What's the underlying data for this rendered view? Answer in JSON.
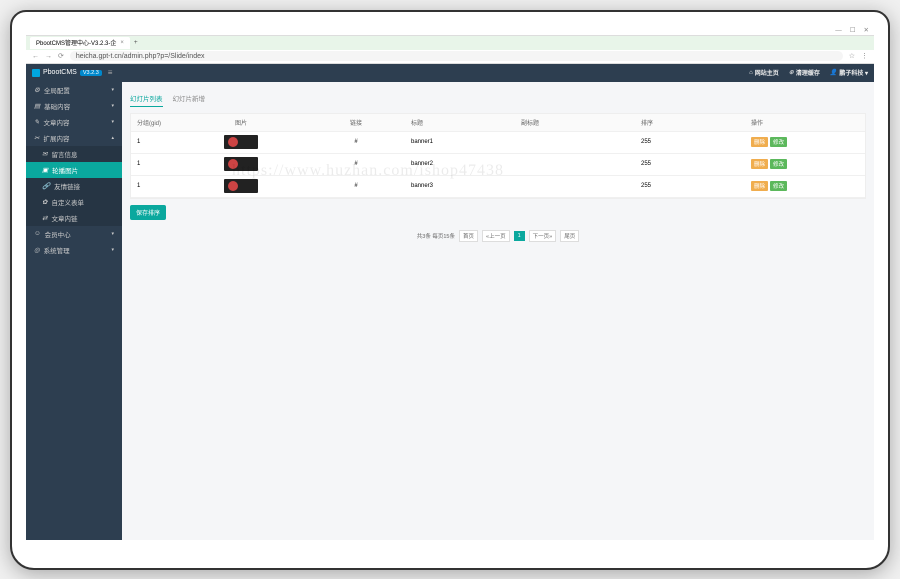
{
  "window": {
    "min": "—",
    "max": "☐",
    "close": "✕"
  },
  "browser": {
    "tab_title": "PbootCMS管理中心-V3.2.3-企",
    "tab_close": "×",
    "add_tab": "+",
    "nav": {
      "back": "←",
      "fwd": "→",
      "reload": "⟳"
    },
    "url": "heicha.gpt-t.cn/admin.php?p=/Slide/index",
    "right_icons": [
      "☆",
      "⋮"
    ]
  },
  "header": {
    "brand": "PbootCMS",
    "ver": "V3.2.3",
    "burger": "≡",
    "links": [
      {
        "icon": "⌂",
        "label": "网站主页"
      },
      {
        "icon": "⊕",
        "label": "清理缓存"
      },
      {
        "icon": "👤",
        "label": "鹏子科技 ▾"
      }
    ]
  },
  "sidebar": [
    {
      "icon": "⚙",
      "label": "全局配置",
      "arr": "▾"
    },
    {
      "icon": "▤",
      "label": "基础内容",
      "arr": "▾"
    },
    {
      "icon": "✎",
      "label": "文章内容",
      "arr": "▾"
    },
    {
      "icon": "✂",
      "label": "扩展内容",
      "arr": "▴",
      "open": true
    },
    {
      "icon": "✉",
      "label": "留言信息",
      "l2": true
    },
    {
      "icon": "▣",
      "label": "轮播图片",
      "l2": true,
      "active": true
    },
    {
      "icon": "🔗",
      "label": "友情链接",
      "l2": true
    },
    {
      "icon": "✿",
      "label": "自定义表单",
      "l2": true
    },
    {
      "icon": "⇄",
      "label": "文章内链",
      "l2": true
    },
    {
      "icon": "☺",
      "label": "会员中心",
      "arr": "▾"
    },
    {
      "icon": "◎",
      "label": "系统管理",
      "arr": "▾"
    }
  ],
  "content": {
    "tabs": [
      {
        "label": "幻灯片列表",
        "active": true
      },
      {
        "label": "幻灯片新增"
      }
    ],
    "cols": [
      "分组(gid)",
      "图片",
      "链接",
      "标题",
      "副标题",
      "排序",
      "操作"
    ],
    "rows": [
      {
        "gid": "1",
        "link": "#",
        "title": "banner1",
        "sub": "",
        "sort": "255"
      },
      {
        "gid": "1",
        "link": "#",
        "title": "banner2",
        "sub": "",
        "sort": "255"
      },
      {
        "gid": "1",
        "link": "#",
        "title": "banner3",
        "sub": "",
        "sort": "255"
      }
    ],
    "row_btn1": "删除",
    "row_btn2": "修改",
    "save": "保存排序",
    "pager": {
      "info": "共3条 每页15条",
      "first": "首页",
      "prev": "«上一页",
      "cur": "1",
      "next": "下一页»",
      "last": "尾页"
    }
  },
  "watermark": "https://www.huzhan.com/ishop47438"
}
